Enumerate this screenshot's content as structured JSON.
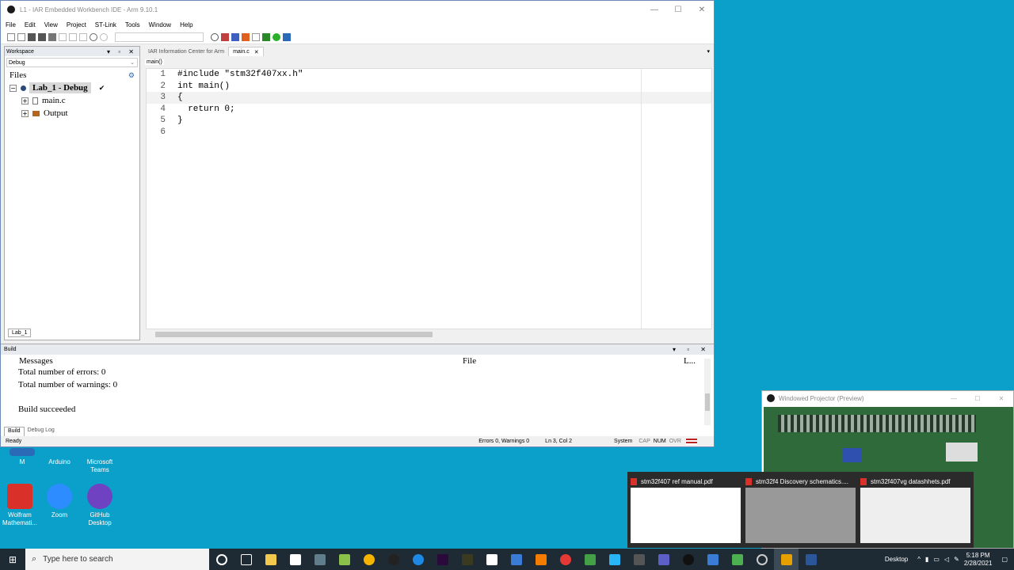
{
  "window": {
    "title": "L1 - IAR Embedded Workbench IDE - Arm 9.10.1",
    "controls": [
      "—",
      "☐",
      "✕"
    ]
  },
  "menu": [
    "File",
    "Edit",
    "View",
    "Project",
    "ST-Link",
    "Tools",
    "Window",
    "Help"
  ],
  "workspace": {
    "title": "Workspace",
    "config": "Debug",
    "files_label": "Files",
    "project": "Lab_1 - Debug",
    "items": [
      "main.c",
      "Output"
    ],
    "tab": "Lab_1"
  },
  "editor": {
    "tabs": [
      "IAR Information Center for Arm",
      "main.c"
    ],
    "function": "main()",
    "lines": [
      {
        "n": "1",
        "text": "#include \"stm32f407xx.h\""
      },
      {
        "n": "2",
        "text": "int main()"
      },
      {
        "n": "3",
        "text": "{"
      },
      {
        "n": "4",
        "text": "  return 0;"
      },
      {
        "n": "5",
        "text": "}"
      },
      {
        "n": "6",
        "text": ""
      }
    ]
  },
  "build": {
    "title": "Build",
    "col_messages": "Messages",
    "col_file": "File",
    "col_line": "L...",
    "messages": [
      "Total number of errors: 0",
      "Total number of warnings: 0",
      "",
      "Build succeeded"
    ],
    "tabs": [
      "Build",
      "Debug Log"
    ]
  },
  "status": {
    "ready": "Ready",
    "errors": "Errors 0, Warnings 0",
    "position": "Ln 3, Col 2",
    "encoding": "System",
    "caps": "CAP",
    "num": "NUM",
    "ovr": "OVR"
  },
  "desktop_icons": [
    {
      "label": "M"
    },
    {
      "label": "Arduino"
    },
    {
      "label": "Microsoft Teams"
    },
    {
      "label": "Wolfram Mathemati..."
    },
    {
      "label": "Zoom"
    },
    {
      "label": "GitHub Desktop"
    }
  ],
  "projector": {
    "title": "Windowed Projector (Preview)"
  },
  "thumbnails": [
    "stm32f407 ref manual.pdf",
    "stm32f4 Discovery schematics....",
    "stm32f407vg datashhets.pdf"
  ],
  "taskbar": {
    "search_placeholder": "Type here to search",
    "desktop_label": "Desktop",
    "time": "5:18 PM",
    "date": "2/28/2021"
  }
}
